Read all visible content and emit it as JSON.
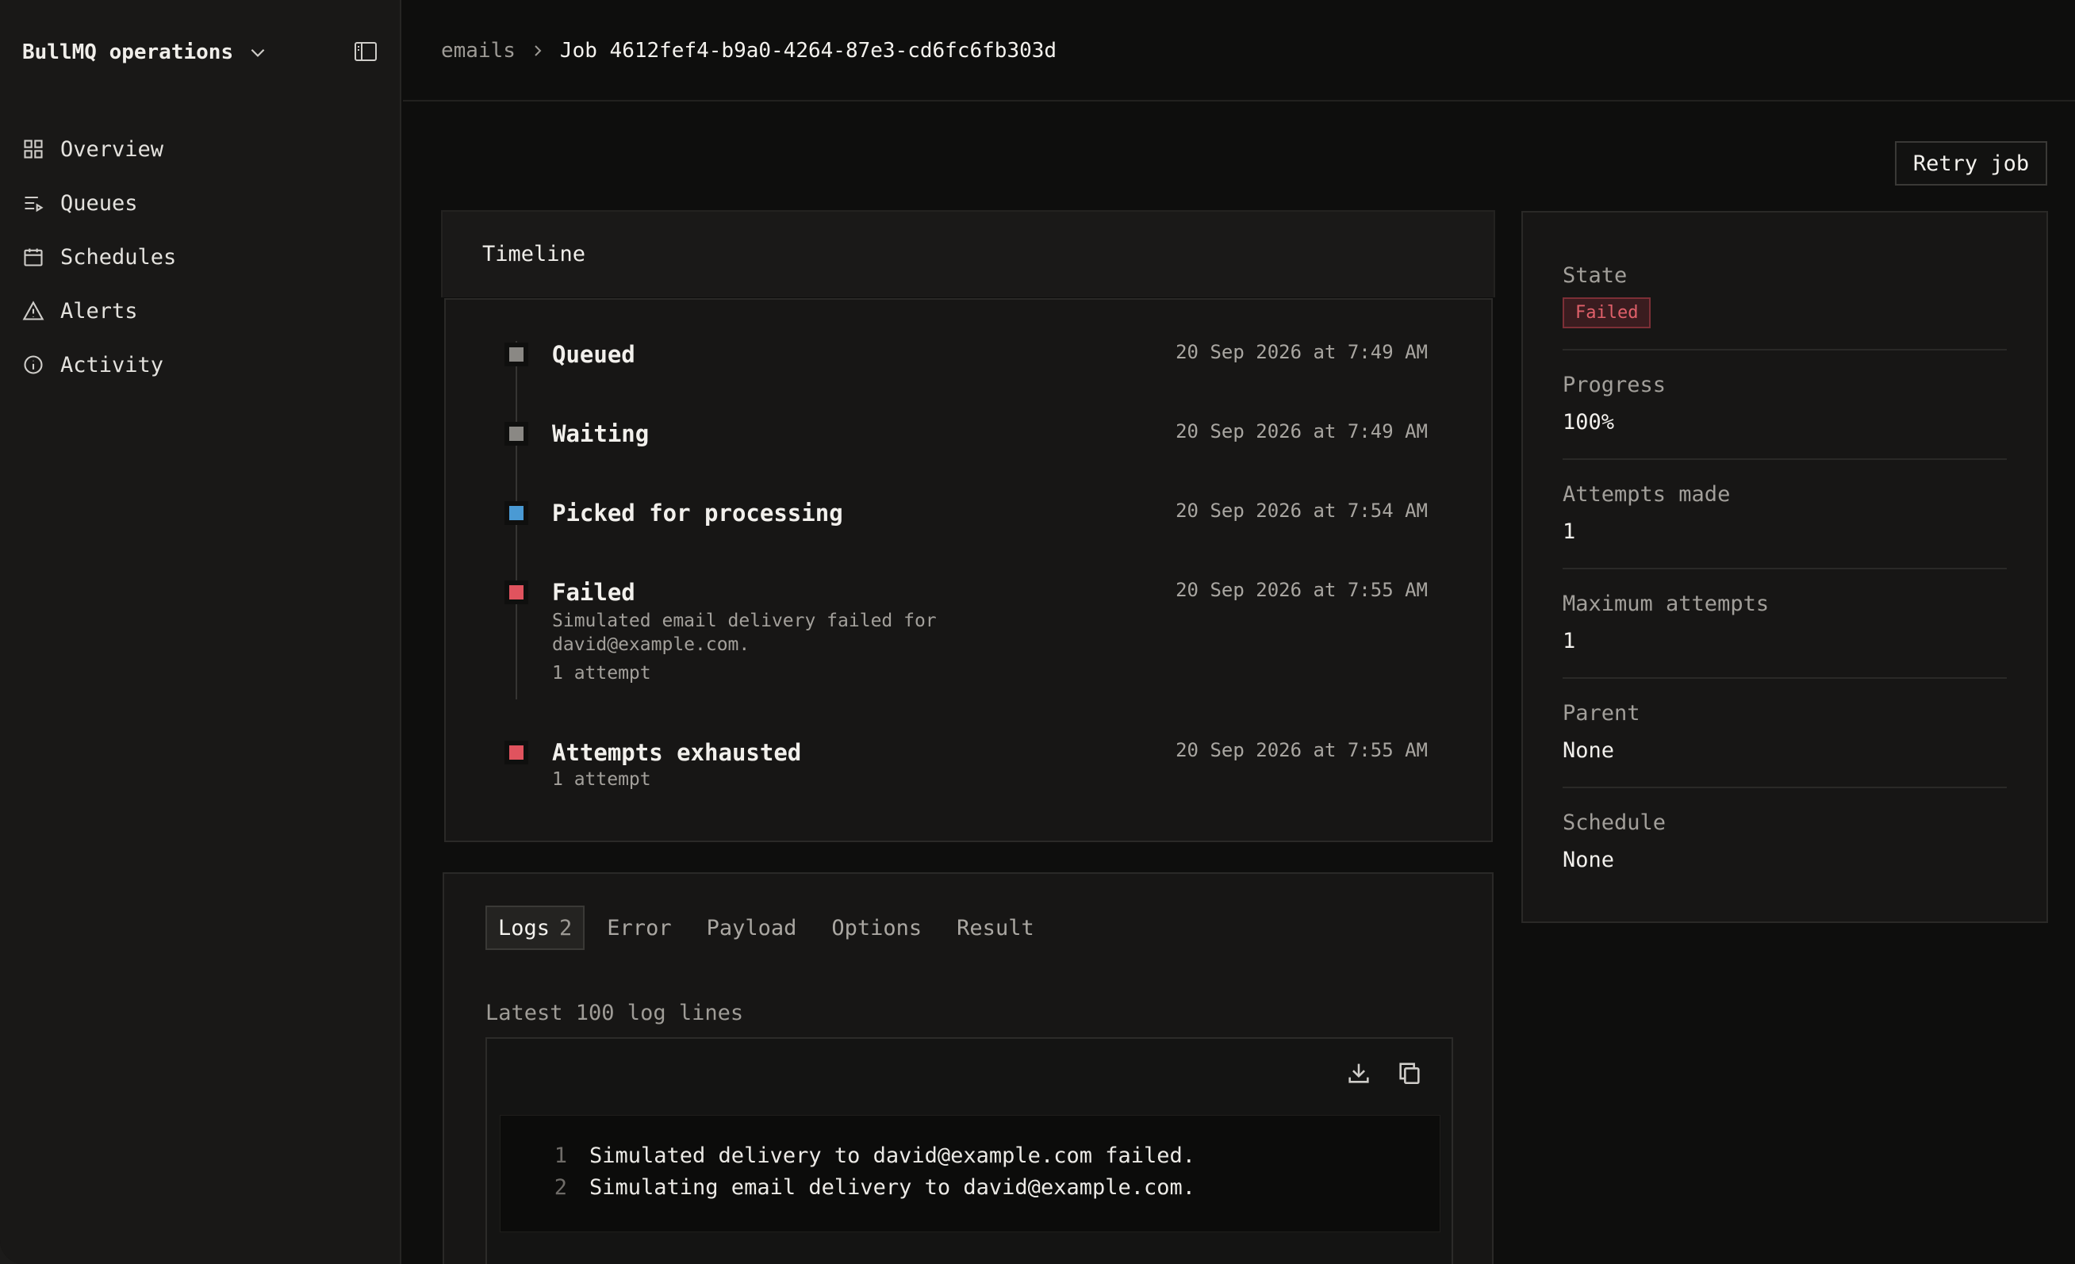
{
  "sidebar": {
    "org_name": "BullMQ operations",
    "items": [
      {
        "label": "Overview",
        "icon": "grid-icon"
      },
      {
        "label": "Queues",
        "icon": "list-play-icon"
      },
      {
        "label": "Schedules",
        "icon": "calendar-icon"
      },
      {
        "label": "Alerts",
        "icon": "warning-triangle-icon"
      },
      {
        "label": "Activity",
        "icon": "info-circle-icon"
      }
    ]
  },
  "breadcrumb": {
    "queue": "emails",
    "current": "Job 4612fef4-b9a0-4264-87e3-cd6fc6fb303d"
  },
  "actions": {
    "retry_label": "Retry job"
  },
  "timeline": {
    "title": "Timeline",
    "events": [
      {
        "title": "Queued",
        "time": "20 Sep 2026 at 7:49 AM",
        "color": "#8a8884"
      },
      {
        "title": "Waiting",
        "time": "20 Sep 2026 at 7:49 AM",
        "color": "#8a8884"
      },
      {
        "title": "Picked for processing",
        "time": "20 Sep 2026 at 7:54 AM",
        "color": "#4a9ad4"
      },
      {
        "title": "Failed",
        "time": "20 Sep 2026 at 7:55 AM",
        "color": "#e0535e",
        "description": "Simulated email delivery failed for david@example.com.",
        "attempts": "1 attempt"
      },
      {
        "title": "Attempts exhausted",
        "time": "20 Sep 2026 at 7:55 AM",
        "color": "#e0535e",
        "attempts": "1 attempt"
      }
    ]
  },
  "tabs": [
    {
      "label": "Logs",
      "count": "2",
      "active": true
    },
    {
      "label": "Error"
    },
    {
      "label": "Payload"
    },
    {
      "label": "Options"
    },
    {
      "label": "Result"
    }
  ],
  "logs": {
    "caption": "Latest 100 log lines",
    "lines": [
      {
        "n": "1",
        "text": "Simulated delivery to david@example.com failed."
      },
      {
        "n": "2",
        "text": "Simulating email delivery to david@example.com."
      }
    ]
  },
  "details": {
    "state_label": "State",
    "state_value": "Failed",
    "progress_label": "Progress",
    "progress_value": "100%",
    "attempts_made_label": "Attempts made",
    "attempts_made_value": "1",
    "max_attempts_label": "Maximum attempts",
    "max_attempts_value": "1",
    "parent_label": "Parent",
    "parent_value": "None",
    "schedule_label": "Schedule",
    "schedule_value": "None"
  }
}
